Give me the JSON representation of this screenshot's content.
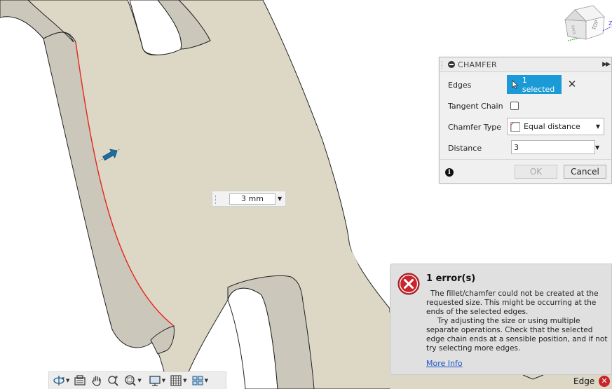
{
  "chamfer": {
    "title": "CHAMFER",
    "edges_label": "Edges",
    "edges_selected": "1 selected",
    "tangent_chain_label": "Tangent Chain",
    "tangent_chain_checked": false,
    "chamfer_type_label": "Chamfer Type",
    "chamfer_type_value": "Equal distance",
    "distance_label": "Distance",
    "distance_value": "3",
    "ok_label": "OK",
    "cancel_label": "Cancel"
  },
  "inline_distance": {
    "value": "3 mm"
  },
  "viewcube": {
    "face_top": "TOP",
    "face_back": "BACK",
    "axis_z": "Z"
  },
  "error": {
    "title": "1 error(s)",
    "paragraph1": "The fillet/chamfer could not be created at the requested size. This might be occurring at the ends of the selected edges.",
    "paragraph2": "Try adjusting the size or using multiple separate operations. Check that the selected edge chain ends at a sensible position, and if not try selecting more edges.",
    "more_info": "More Info"
  },
  "status": {
    "label": "Edge"
  },
  "colors": {
    "part_face": "#ddd8c6",
    "part_side": "#c8c5b8",
    "selected_edge": "#e8291f",
    "accent_blue": "#1a9ad6",
    "error_red": "#c8252c"
  },
  "toolbar_icons": [
    "orbit-icon",
    "look-at-icon",
    "pan-icon",
    "zoom-icon",
    "zoom-window-icon",
    "display-settings-icon",
    "grid-icon",
    "viewports-icon"
  ]
}
